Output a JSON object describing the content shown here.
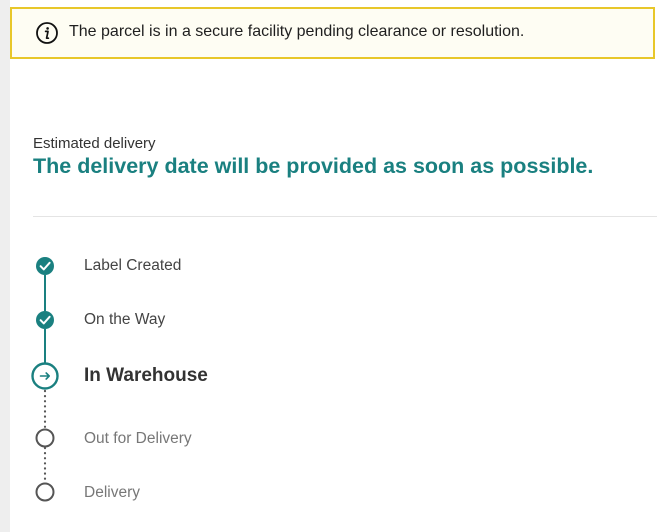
{
  "alert": {
    "icon": "info-circle-icon",
    "text": "The parcel is in a secure facility pending clearance or resolution.",
    "border_color": "#e8c72a"
  },
  "estimate": {
    "label": "Estimated delivery",
    "value": "The delivery date will be provided as soon as possible.",
    "accent_color": "#1a8080"
  },
  "timeline": {
    "steps": [
      {
        "label": "Label Created",
        "status": "completed",
        "icon": "check-circle-icon"
      },
      {
        "label": "On the Way",
        "status": "completed",
        "icon": "check-circle-icon"
      },
      {
        "label": "In Warehouse",
        "status": "current",
        "icon": "arrow-right-circle-icon"
      },
      {
        "label": "Out for Delivery",
        "status": "pending",
        "icon": "empty-circle-icon"
      },
      {
        "label": "Delivery",
        "status": "pending",
        "icon": "empty-circle-icon"
      }
    ]
  }
}
